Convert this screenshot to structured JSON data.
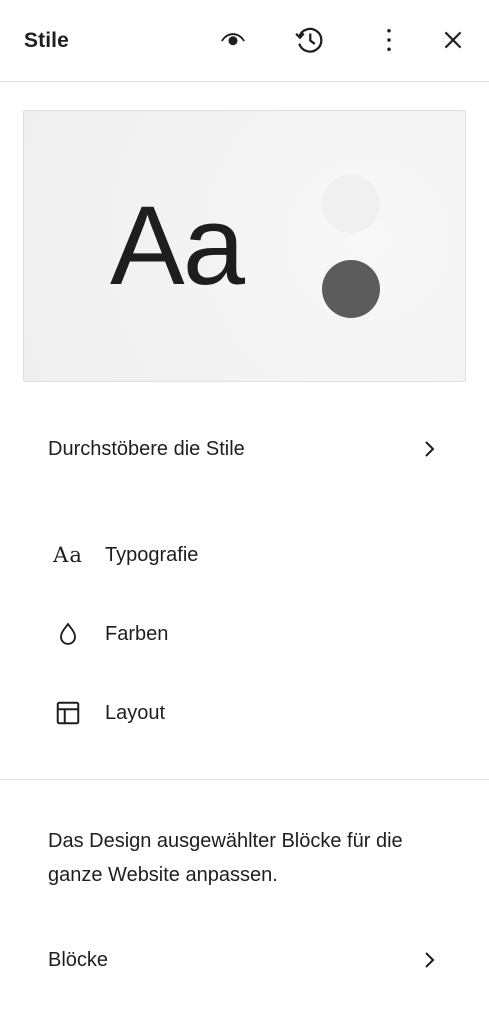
{
  "header": {
    "title": "Stile",
    "icons": [
      "eye-icon",
      "history-icon",
      "more-vertical-icon",
      "close-icon"
    ]
  },
  "preview": {
    "sample_text": "Aa",
    "colors": {
      "light_dot": "#f0f0f0",
      "dark_dot": "#5c5c5c",
      "background": "#f3f3f3"
    }
  },
  "browse": {
    "label": "Durchstöbere die Stile"
  },
  "items": [
    {
      "label": "Typografie",
      "icon": "typography-icon",
      "glyph": "Aa"
    },
    {
      "label": "Farben",
      "icon": "color-drop-icon"
    },
    {
      "label": "Layout",
      "icon": "layout-icon"
    }
  ],
  "blocks_section": {
    "description": "Das Design ausgewählter Blöcke für die ganze Website anpassen.",
    "label": "Blöcke"
  },
  "colors": {
    "text": "#1e1e1e",
    "border": "#e0e0e0",
    "background": "#ffffff"
  }
}
